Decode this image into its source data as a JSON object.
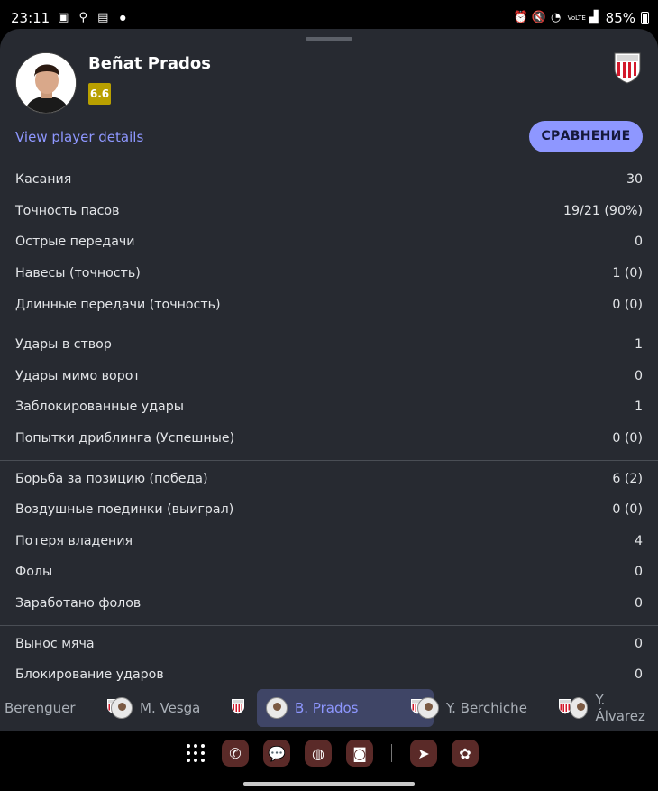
{
  "status": {
    "time": "23:11",
    "battery": "85%",
    "left_icons": [
      "image-icon",
      "walk-icon",
      "document-icon",
      "dot-icon"
    ],
    "right_icons": [
      "alarm-icon",
      "mute-icon",
      "wifi-icon",
      "volte-icon",
      "signal-icon",
      "battery-icon"
    ],
    "volte_label": "VoLTE"
  },
  "player": {
    "name": "Beñat Prados",
    "rating": "6.6",
    "rating_color": "#b9a000"
  },
  "actions": {
    "details_link": "View player details",
    "compare_button": "СРАВНЕНИЕ"
  },
  "stat_groups": [
    [
      {
        "label": "Касания",
        "value": "30"
      },
      {
        "label": "Точность пасов",
        "value": "19/21 (90%)"
      },
      {
        "label": "Острые передачи",
        "value": "0"
      },
      {
        "label": "Навесы (точность)",
        "value": "1 (0)"
      },
      {
        "label": "Длинные передачи (точность)",
        "value": "0 (0)"
      }
    ],
    [
      {
        "label": "Удары в створ",
        "value": "1"
      },
      {
        "label": "Удары мимо ворот",
        "value": "0"
      },
      {
        "label": "Заблокированные удары",
        "value": "1"
      },
      {
        "label": "Попытки дриблинга (Успешные)",
        "value": "0 (0)"
      }
    ],
    [
      {
        "label": "Борьба за позицию (победа)",
        "value": "6 (2)"
      },
      {
        "label": "Воздушные поединки (выиграл)",
        "value": "0 (0)"
      },
      {
        "label": "Потеря владения",
        "value": "4"
      },
      {
        "label": "Фолы",
        "value": "0"
      },
      {
        "label": "Заработано фолов",
        "value": "0"
      }
    ],
    [
      {
        "label": "Вынос мяча",
        "value": "0"
      },
      {
        "label": "Блокирование ударов",
        "value": "0"
      }
    ]
  ],
  "player_tabs": [
    {
      "name": "Berenguer",
      "active": false,
      "has_avatar": false
    },
    {
      "name": "M. Vesga",
      "active": false,
      "has_avatar": true
    },
    {
      "name": "B. Prados",
      "active": true,
      "has_avatar": true
    },
    {
      "name": "Y. Berchiche",
      "active": false,
      "has_avatar": true
    },
    {
      "name": "Y. Álvarez",
      "active": false,
      "has_avatar": true
    }
  ],
  "dock": {
    "apps": [
      "phone-icon",
      "messages-icon",
      "browser-icon",
      "camera-icon",
      "telegram-icon",
      "flower-icon"
    ]
  },
  "colors": {
    "sheet_bg": "#272a31",
    "accent": "#8e97ff",
    "active_tab_bg": "#3f4566"
  }
}
